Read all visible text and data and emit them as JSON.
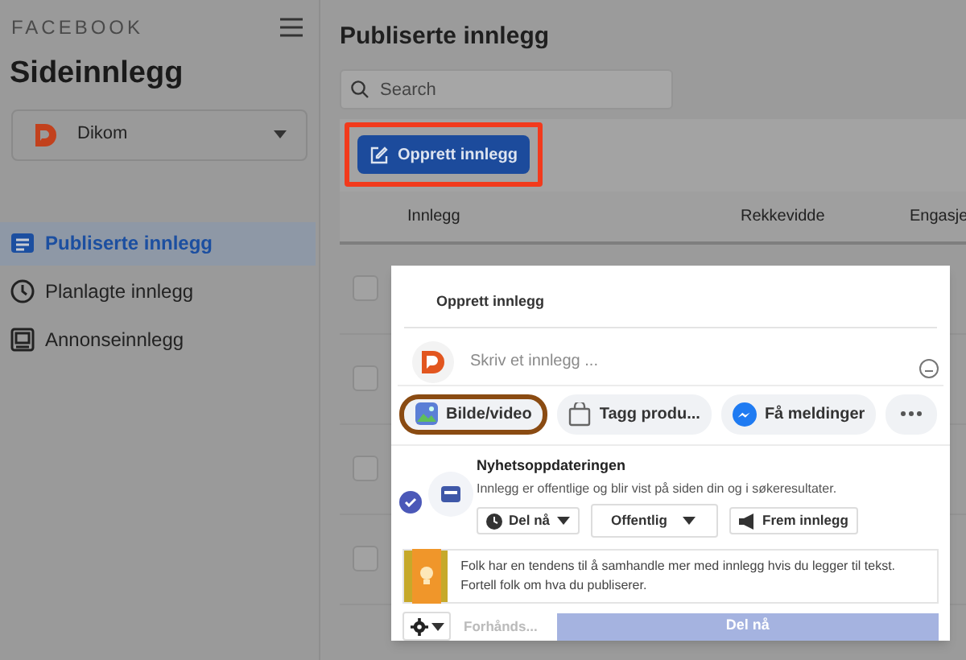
{
  "sidebar": {
    "brand": "FACEBOOK",
    "title": "Sideinnlegg",
    "page_selector": {
      "name": "Dikom"
    },
    "items": [
      {
        "label": "Publiserte innlegg",
        "kind": "list",
        "selected": true
      },
      {
        "label": "Planlagte innlegg",
        "kind": "clock",
        "selected": false
      },
      {
        "label": "Annonseinnlegg",
        "kind": "screen",
        "selected": false
      }
    ]
  },
  "main": {
    "title": "Publiserte innlegg",
    "search": {
      "placeholder": "Search"
    },
    "create_button": {
      "label": "Opprett innlegg",
      "highlighted": true
    },
    "table": {
      "columns": [
        "Innlegg",
        "Rekkevidde",
        "Engasje"
      ],
      "rows": [
        {
          "checked": false
        },
        {
          "checked": false
        },
        {
          "checked": false
        },
        {
          "checked": false
        }
      ]
    }
  },
  "composer": {
    "title": "Opprett innlegg",
    "placeholder": "Skriv et innlegg ...",
    "actions": [
      {
        "label": "Bilde/video",
        "kind": "photo",
        "highlighted": true
      },
      {
        "label": "Tagg produ...",
        "kind": "bag",
        "highlighted": false
      },
      {
        "label": "Få meldinger",
        "kind": "messenger",
        "highlighted": false
      },
      {
        "kind": "more",
        "highlighted": false
      }
    ],
    "placement": {
      "title": "Nyhetsoppdateringen",
      "description": "Innlegg er offentlige og blir vist på siden din og i søkeresultater.",
      "checked": true,
      "controls": [
        {
          "label": "Del nå",
          "kind": "schedule"
        },
        {
          "label": "Offentlig",
          "kind": "audience"
        },
        {
          "label": "Frem innlegg",
          "kind": "boost"
        }
      ]
    },
    "tip": "Folk har en tendens til å samhandle mer med innlegg hvis du legger til tekst. Fortell folk om hva du publiserer.",
    "footer": {
      "preview": "Forhånds...",
      "submit": "Del nå",
      "submit_disabled": true
    }
  }
}
